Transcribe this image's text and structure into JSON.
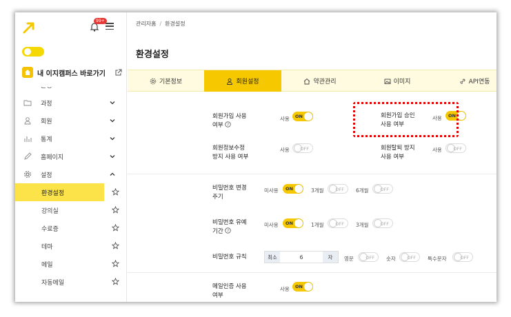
{
  "sidebar": {
    "badge": "99+",
    "home_link": "내 이지캠퍼스 바로가기",
    "partial_item": "운영",
    "items": [
      {
        "label": "과정",
        "icon": "folder-icon"
      },
      {
        "label": "회원",
        "icon": "user-icon"
      },
      {
        "label": "통계",
        "icon": "bar-chart-icon"
      },
      {
        "label": "홈페이지",
        "icon": "pencil-icon"
      },
      {
        "label": "설정",
        "icon": "gear-icon"
      }
    ],
    "subitems": [
      "환경설정",
      "강의실",
      "수료증",
      "테마",
      "메일",
      "자동메일"
    ]
  },
  "breadcrumb": {
    "parent": "관리자홈",
    "sep": "/",
    "current": "환경설정"
  },
  "page_title": "환경설정",
  "tabs": [
    "기본정보",
    "회원설정",
    "약관관리",
    "이미지",
    "API연동"
  ],
  "settings": {
    "signup_use": {
      "label_1": "회원가입 사용",
      "label_2": "여부",
      "option": "사용",
      "state": "ON"
    },
    "signup_approve": {
      "label_1": "회원가입 승인",
      "label_2": "사용 여부",
      "option": "사용",
      "state": "ON"
    },
    "info_edit_block": {
      "label_1": "회원정보수정",
      "label_2": "방지 사용 여부",
      "option": "사용",
      "state": "OFF"
    },
    "withdraw_block": {
      "label_1": "회원탈퇴 방지",
      "label_2": "사용 여부",
      "option": "사용",
      "state": "OFF"
    },
    "pw_change_cycle": {
      "label_1": "비밀번호 변경",
      "label_2": "주기",
      "options": [
        "미사용",
        "3개월",
        "6개월"
      ],
      "states": [
        "ON",
        "OFF",
        "OFF"
      ]
    },
    "pw_grace": {
      "label_1": "비밀번호 유예",
      "label_2": "기간",
      "options": [
        "미사용",
        "1개월",
        "3개월"
      ],
      "states": [
        "ON",
        "OFF",
        "OFF"
      ]
    },
    "pw_rule": {
      "label": "비밀번호 규칙",
      "prefix": "최소",
      "value": "6",
      "suffix": "자",
      "options": [
        "영문",
        "숫자",
        "특수문자"
      ],
      "states": [
        "OFF",
        "OFF",
        "OFF"
      ]
    },
    "email_verify": {
      "label_1": "메일인증 사용",
      "label_2": "여부",
      "option": "사용",
      "state": "ON"
    }
  },
  "colors": {
    "accent": "#f5c800",
    "highlight": "#e00000"
  }
}
